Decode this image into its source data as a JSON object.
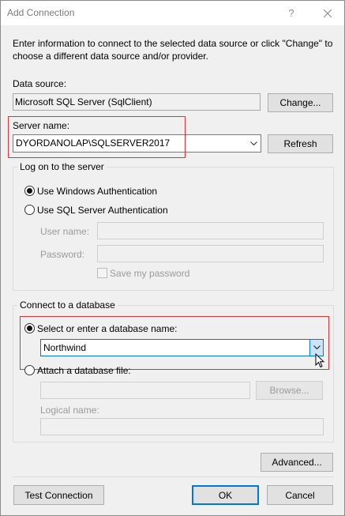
{
  "window": {
    "title": "Add Connection",
    "help_glyph": "?",
    "intro_text": "Enter information to connect to the selected data source or click \"Change\" to choose a different data source and/or provider."
  },
  "data_source": {
    "label": "Data source:",
    "value": "Microsoft SQL Server (SqlClient)",
    "change_label": "Change..."
  },
  "server": {
    "label": "Server name:",
    "value": "DYORDANOLAP\\SQLSERVER2017",
    "refresh_label": "Refresh"
  },
  "logon": {
    "title": "Log on to the server",
    "windows_auth_label": "Use Windows Authentication",
    "sql_auth_label": "Use SQL Server Authentication",
    "selected": "windows",
    "username_label": "User name:",
    "username_value": "",
    "password_label": "Password:",
    "password_value": "",
    "save_password_label": "Save my password",
    "save_password_checked": false
  },
  "database": {
    "title": "Connect to a database",
    "select_label": "Select or enter a database name:",
    "select_value": "Northwind",
    "attach_label": "Attach a database file:",
    "attach_value": "",
    "browse_label": "Browse...",
    "logical_label": "Logical name:",
    "logical_value": "",
    "selected": "select"
  },
  "footer": {
    "advanced_label": "Advanced...",
    "test_label": "Test Connection",
    "ok_label": "OK",
    "cancel_label": "Cancel"
  },
  "colors": {
    "highlight_box": "#d9343a",
    "focus_accent": "#0078d7"
  }
}
